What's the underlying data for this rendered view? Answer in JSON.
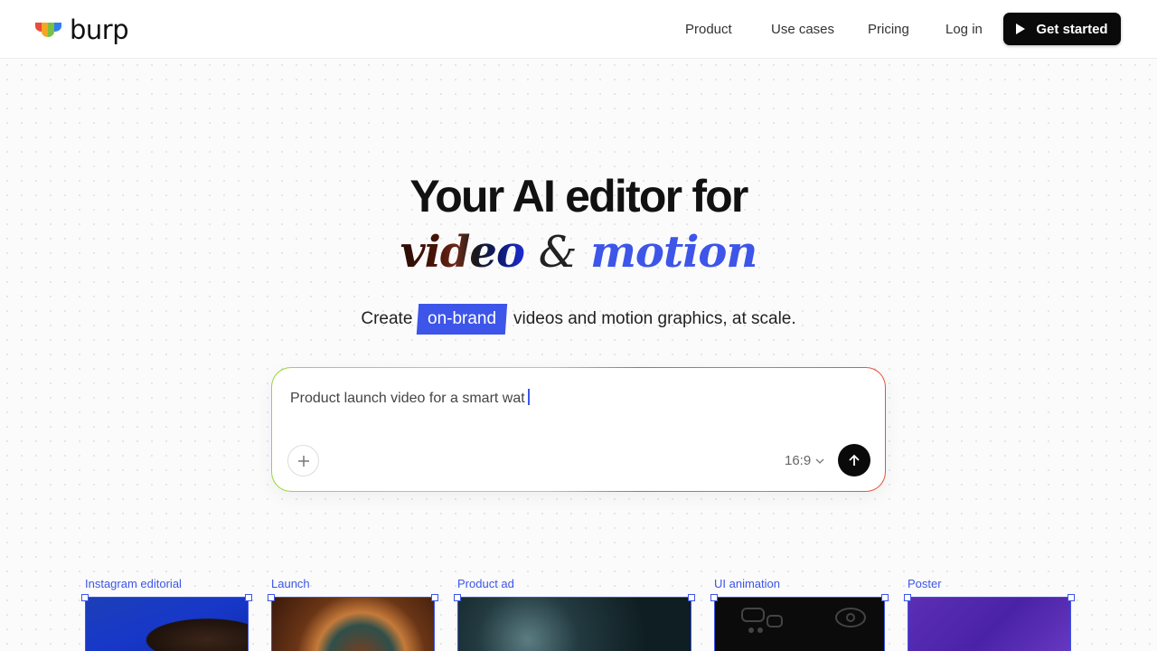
{
  "nav": {
    "logo_text": "burp",
    "links": [
      "Product",
      "Use cases",
      "Pricing",
      "Log in"
    ],
    "cta_label": "Get started"
  },
  "hero": {
    "title_line1": "Your AI editor for",
    "title_word_video": "video",
    "title_amp": "&",
    "title_word_motion": "motion",
    "subtitle_pre": "Create",
    "subtitle_highlight": "on-brand",
    "subtitle_post": "videos and motion graphics, at scale."
  },
  "prompt": {
    "value": "Product launch video for a smart wat",
    "aspect_ratio": "16:9"
  },
  "cards": [
    {
      "label": "Instagram editorial"
    },
    {
      "label": "Launch"
    },
    {
      "label": "Product ad"
    },
    {
      "label": "UI animation"
    },
    {
      "label": "Poster"
    }
  ],
  "colors": {
    "accent": "#3d55e8",
    "button_dark": "#0a0a0a"
  },
  "icons": [
    "logo-mark-icon",
    "play-icon",
    "plus-icon",
    "chevron-down-icon",
    "arrow-up-icon"
  ]
}
